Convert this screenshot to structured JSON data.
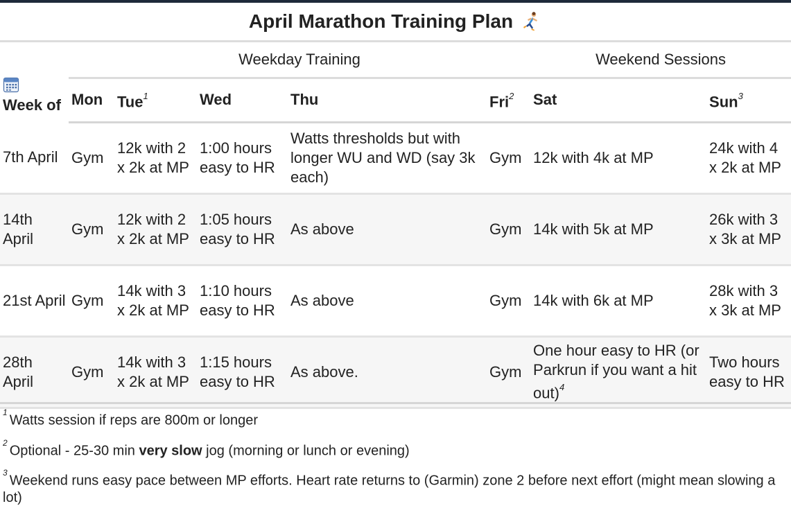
{
  "title": "April Marathon Training Plan",
  "icons": {
    "title_icon": "runner-emoji-icon",
    "calendar_icon": "calendar-icon"
  },
  "colors": {
    "header_bar": "#1e2a3a",
    "divider": "#dcdcdc",
    "row_alt": "#f6f6f6",
    "text": "#222222"
  },
  "groups": {
    "weekday": "Weekday Training",
    "weekend": "Weekend Sessions"
  },
  "columns": {
    "week_of": "Week of",
    "mon": "Mon",
    "tue": "Tue",
    "tue_note": "1",
    "wed": "Wed",
    "thu": "Thu",
    "fri": "Fri",
    "fri_note": "2",
    "sat": "Sat",
    "sun": "Sun",
    "sun_note": "3"
  },
  "rows": [
    {
      "week": "7th April",
      "mon": "Gym",
      "tue": "12k with 2 x 2k at MP",
      "wed": "1:00 hours easy to HR",
      "thu": "Watts thresholds but with longer WU and WD (say 3k each)",
      "fri": "Gym",
      "sat": "12k with 4k at MP",
      "sat_note": "",
      "sun": "24k with 4 x 2k at MP"
    },
    {
      "week": "14th April",
      "mon": "Gym",
      "tue": "12k with 2 x 2k at MP",
      "wed": "1:05 hours easy to HR",
      "thu": "As above",
      "fri": "Gym",
      "sat": "14k with 5k at MP",
      "sat_note": "",
      "sun": "26k with 3 x 3k at MP"
    },
    {
      "week": "21st April",
      "mon": "Gym",
      "tue": "14k with 3 x 2k at MP",
      "wed": "1:10 hours easy to HR",
      "thu": "As above",
      "fri": "Gym",
      "sat": "14k with 6k at MP",
      "sat_note": "",
      "sun": "28k with 3 x 3k at MP"
    },
    {
      "week": "28th April",
      "mon": "Gym",
      "tue": "14k with 3 x 2k at MP",
      "wed": "1:15 hours easy to HR",
      "thu": "As above.",
      "fri": "Gym",
      "sat": "One hour easy to HR (or Parkrun if you want a hit out)",
      "sat_note": "4",
      "sun": "Two hours easy to HR"
    }
  ],
  "footnotes": [
    {
      "num": "1",
      "text": "Watts session if reps are 800m or longer"
    },
    {
      "num": "2",
      "text_before": "Optional - 25-30 min ",
      "bold": "very slow",
      "text_after": " jog (morning or lunch or evening)"
    },
    {
      "num": "3",
      "text": "Weekend runs easy pace between MP efforts. Heart rate returns to (Garmin) zone 2 before next effort (might mean slowing a lot)"
    }
  ]
}
